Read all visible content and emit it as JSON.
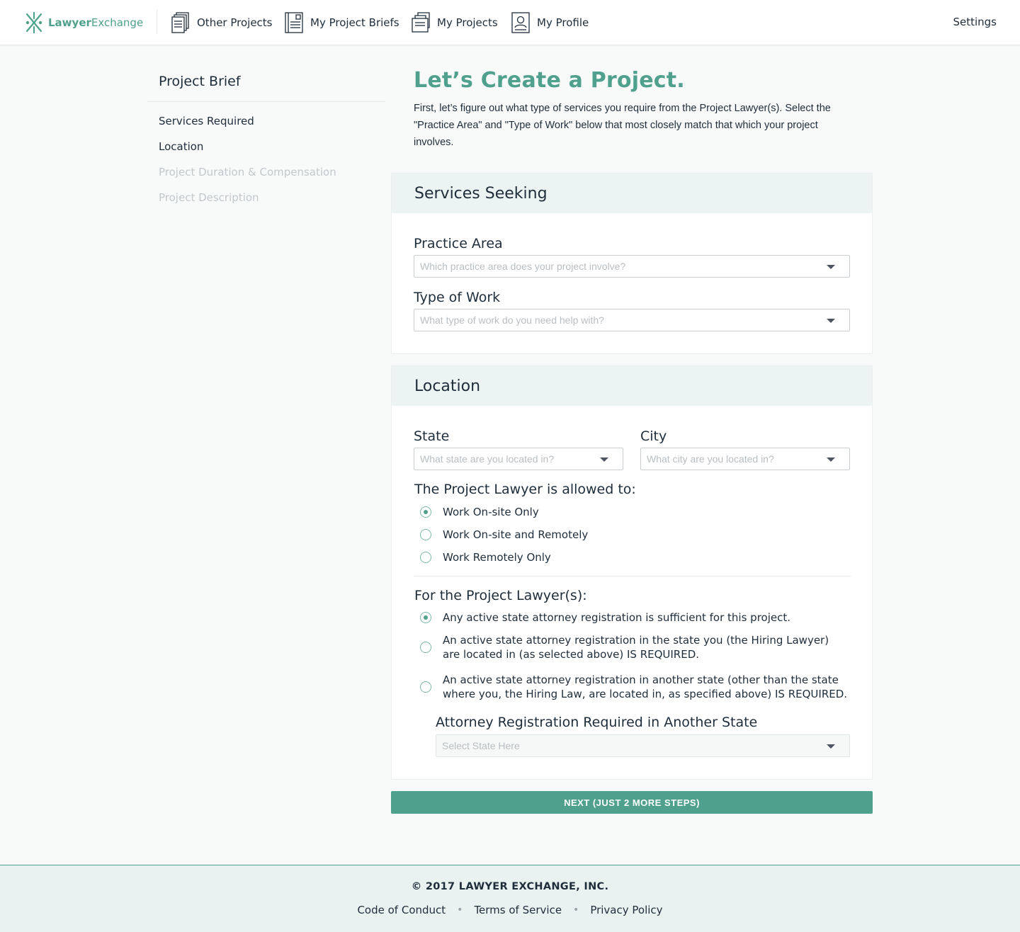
{
  "brand": {
    "name_bold": "Lawyer",
    "name_light": "Exchange",
    "logo_icon": "lawyer-exchange-logo-icon",
    "accent": "#4fa08c"
  },
  "nav": {
    "items": [
      {
        "label": "Other Projects",
        "icon": "documents-stack-icon"
      },
      {
        "label": "My Project Briefs",
        "icon": "document-brief-icon"
      },
      {
        "label": "My Projects",
        "icon": "folder-documents-icon"
      },
      {
        "label": "My Profile",
        "icon": "profile-card-icon"
      }
    ],
    "settings": "Settings"
  },
  "sidebar": {
    "title": "Project Brief",
    "items": [
      {
        "label": "Services Required",
        "state": "active"
      },
      {
        "label": "Location",
        "state": "active"
      },
      {
        "label": "Project Duration & Compensation",
        "state": "inactive"
      },
      {
        "label": "Project Description",
        "state": "inactive"
      }
    ]
  },
  "main": {
    "title": "Let’s Create a Project.",
    "intro": "First, let’s figure out what type of services you require from the Project Lawyer(s). Select the \"Practice Area\" and \"Type of Work\" below that most closely match that which your project involves."
  },
  "services": {
    "heading": "Services Seeking",
    "practice_area": {
      "label": "Practice Area",
      "placeholder": "Which practice area does your project involve?"
    },
    "type_of_work": {
      "label": "Type of Work",
      "placeholder": "What type of work do you need help with?"
    }
  },
  "location": {
    "heading": "Location",
    "state": {
      "label": "State",
      "placeholder": "What state are you located in?"
    },
    "city": {
      "label": "City",
      "placeholder": "What city are you located in?"
    },
    "allowed_label": "The Project Lawyer is allowed to:",
    "allowed_options": [
      {
        "label": "Work On-site Only",
        "checked": true
      },
      {
        "label": "Work On-site and Remotely",
        "checked": false
      },
      {
        "label": "Work Remotely Only",
        "checked": false
      }
    ],
    "registration_label": "For the Project Lawyer(s):",
    "registration_options": [
      {
        "label": "Any active state attorney registration is sufficient for this project.",
        "checked": true
      },
      {
        "label": "An active state attorney registration in the state you (the Hiring Lawyer) are located in (as selected above) IS REQUIRED.",
        "checked": false
      },
      {
        "label": "An active state attorney registration in another state (other than the state where you, the Hiring Law, are located in, as specified above) IS REQUIRED.",
        "checked": false
      }
    ],
    "other_state": {
      "label": "Attorney Registration Required in Another State",
      "placeholder": "Select State Here"
    }
  },
  "next_button": "NEXT (JUST 2 MORE STEPS)",
  "footer": {
    "copyright": "© 2017 LAWYER EXCHANGE, INC.",
    "links": [
      "Code of Conduct",
      "Terms of Service",
      "Privacy Policy"
    ]
  }
}
